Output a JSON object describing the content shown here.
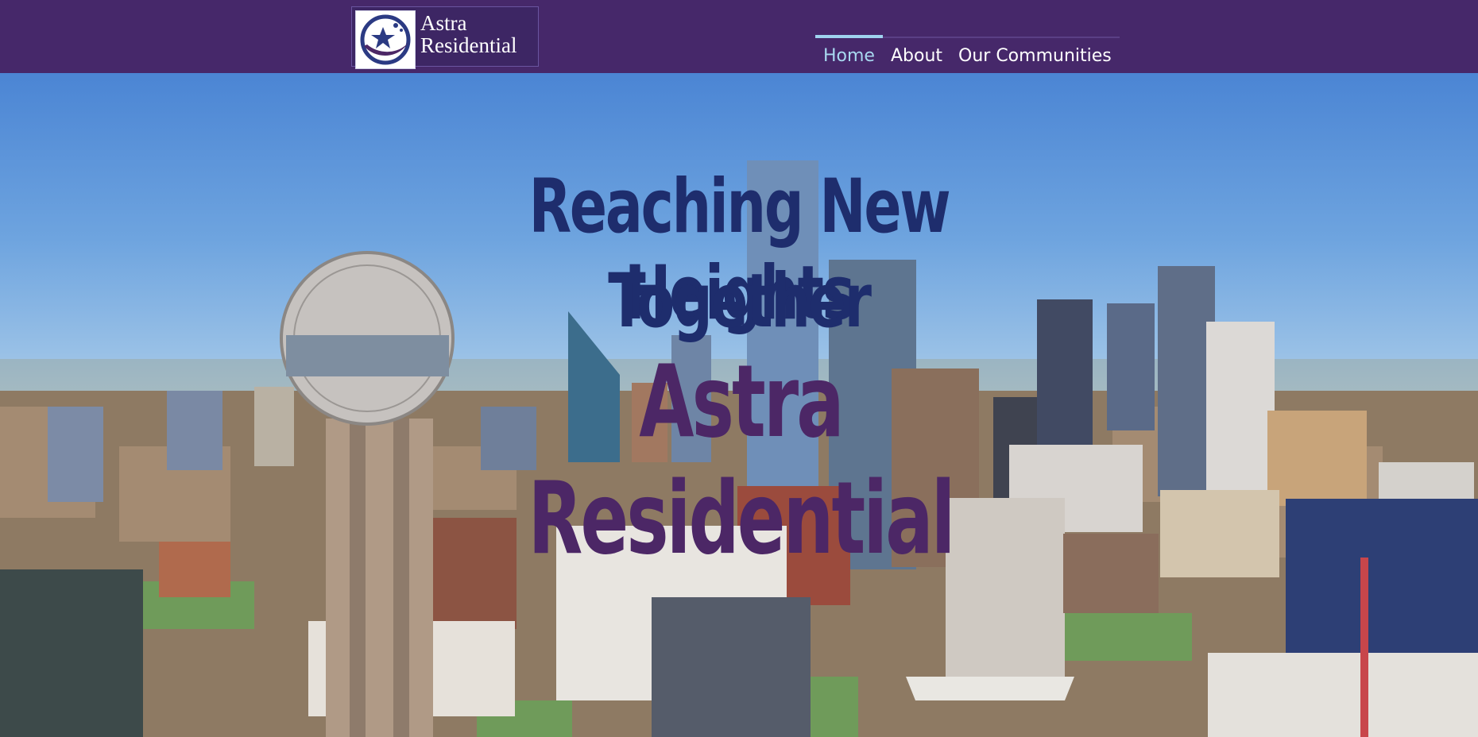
{
  "brand": {
    "name": "Astra Residential",
    "logo_line1": "Astra",
    "logo_line2": "Residential",
    "logo_icon": "star-swoosh-icon"
  },
  "nav": {
    "items": [
      {
        "label": "Home",
        "active": true
      },
      {
        "label": "About",
        "active": false
      },
      {
        "label": "Our Communities",
        "active": false
      }
    ]
  },
  "hero": {
    "headline_line1": "Reaching New Heights",
    "headline_line2": "Together",
    "brand_title": "Astra Residential",
    "background": "aerial-city-skyline-photo"
  },
  "colors": {
    "header_bg": "#46286a",
    "nav_active": "#a8d8f0",
    "headline": "#1e2d6d",
    "brand_title": "#4c2766"
  }
}
